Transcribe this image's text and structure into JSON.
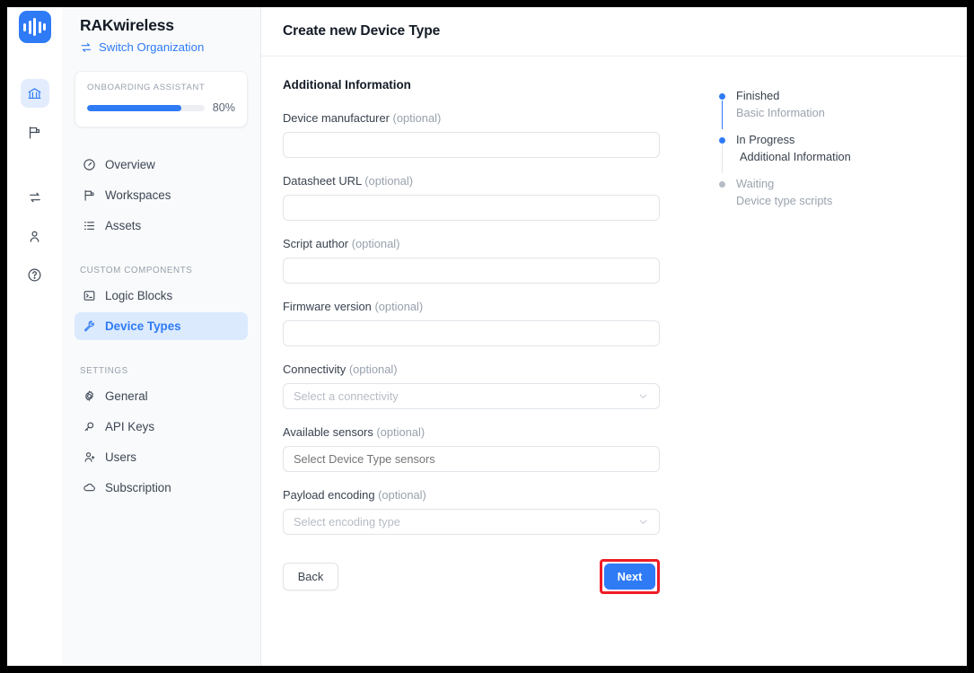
{
  "window": {
    "frame_color": "#000000"
  },
  "brand": {
    "logo_icon": "waveform-logo-icon",
    "accent": "#2f7bf6"
  },
  "rail": {
    "items": [
      {
        "icon": "bank-icon",
        "name": "organization",
        "active": true
      },
      {
        "icon": "flag-icon",
        "name": "workspaces",
        "active": false
      },
      {
        "icon": "swap-icon",
        "name": "transfer",
        "active": false
      },
      {
        "icon": "user-icon",
        "name": "account",
        "active": false
      },
      {
        "icon": "help-circle-icon",
        "name": "help",
        "active": false
      }
    ]
  },
  "sidebar": {
    "org_name": "RAKwireless",
    "switch_org_label": "Switch Organization",
    "switch_org_icon": "swap-arrows-icon",
    "onboarding": {
      "title": "ONBOARDING ASSISTANT",
      "percent_label": "80%",
      "percent_value": 80
    },
    "groups": [
      {
        "label": "",
        "items": [
          {
            "label": "Overview",
            "icon": "gauge-icon",
            "active": false
          },
          {
            "label": "Workspaces",
            "icon": "flag-icon",
            "active": false
          },
          {
            "label": "Assets",
            "icon": "list-icon",
            "active": false
          }
        ]
      },
      {
        "label": "CUSTOM COMPONENTS",
        "items": [
          {
            "label": "Logic Blocks",
            "icon": "terminal-icon",
            "active": false
          },
          {
            "label": "Device Types",
            "icon": "wrench-icon",
            "active": true
          }
        ]
      },
      {
        "label": "SETTINGS",
        "items": [
          {
            "label": "General",
            "icon": "gear-icon",
            "active": false
          },
          {
            "label": "API Keys",
            "icon": "key-icon",
            "active": false
          },
          {
            "label": "Users",
            "icon": "user-add-icon",
            "active": false
          },
          {
            "label": "Subscription",
            "icon": "cloud-icon",
            "active": false
          }
        ]
      }
    ]
  },
  "header": {
    "title": "Create new Device Type"
  },
  "form": {
    "section_title": "Additional Information",
    "optional_suffix": "(optional)",
    "fields": [
      {
        "label": "Device manufacturer",
        "optional": "(optional)",
        "type": "text",
        "value": "",
        "placeholder": ""
      },
      {
        "label": "Datasheet URL",
        "optional": "(optional)",
        "type": "text",
        "value": "",
        "placeholder": ""
      },
      {
        "label": "Script author",
        "optional": "(optional)",
        "type": "text",
        "value": "",
        "placeholder": ""
      },
      {
        "label": "Firmware version",
        "optional": "(optional)",
        "type": "text",
        "value": "",
        "placeholder": ""
      },
      {
        "label": "Connectivity",
        "optional": "(optional)",
        "type": "select",
        "value": "",
        "placeholder": "Select a connectivity"
      },
      {
        "label": "Available sensors",
        "optional": "(optional)",
        "type": "text",
        "value": "",
        "placeholder": "Select Device Type sensors"
      },
      {
        "label": "Payload encoding",
        "optional": "(optional)",
        "type": "select",
        "value": "",
        "placeholder": "Select encoding type"
      }
    ],
    "back_label": "Back",
    "next_label": "Next",
    "next_highlight_color": "#ee1c25"
  },
  "stepper": {
    "steps": [
      {
        "status": "Finished",
        "name": "Basic Information",
        "state": "done"
      },
      {
        "status": "In Progress",
        "name": "Additional Information",
        "state": "active"
      },
      {
        "status": "Waiting",
        "name": "Device type scripts",
        "state": "wait"
      }
    ]
  }
}
